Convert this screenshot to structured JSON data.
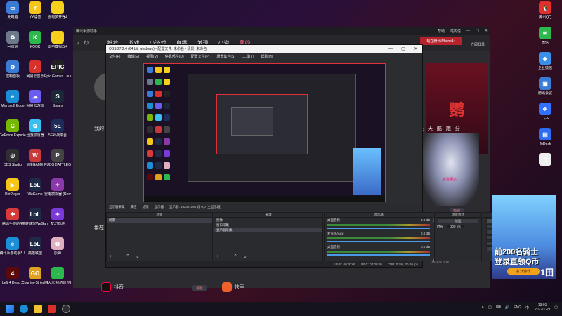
{
  "desktop_left": [
    {
      "label": "此电脑",
      "color": "#3a7bd5",
      "glyph": "▭"
    },
    {
      "label": "YY语音",
      "color": "#f5c518",
      "glyph": "Y"
    },
    {
      "label": "雷电多开器4",
      "color": "#f7d21a",
      "glyph": "⚡"
    },
    {
      "label": "回收站",
      "color": "#6d7a8c",
      "glyph": "♻"
    },
    {
      "label": "KOOK",
      "color": "#2db84d",
      "glyph": "K"
    },
    {
      "label": "雷电模拟器4",
      "color": "#f7d21a",
      "glyph": "⚡"
    },
    {
      "label": "控制面板",
      "color": "#3a7bd5",
      "glyph": "⚙"
    },
    {
      "label": "网易云音乐",
      "color": "#d8302a",
      "glyph": "♪"
    },
    {
      "label": "Epic Games Launcher",
      "color": "#222",
      "glyph": "EPIC"
    },
    {
      "label": "Microsoft Edge",
      "color": "#1a8fd8",
      "glyph": "e"
    },
    {
      "label": "网易云游戏",
      "color": "#6a5cf0",
      "glyph": "☁"
    },
    {
      "label": "Steam",
      "color": "#1b2838",
      "glyph": "S"
    },
    {
      "label": "GeForce Experience",
      "color": "#76b900",
      "glyph": "G"
    },
    {
      "label": "迅游加速器",
      "color": "#3ac0f0",
      "glyph": "✿"
    },
    {
      "label": "5E对战平台",
      "color": "#1e2c5a",
      "glyph": "5E"
    },
    {
      "label": "OBS Studio",
      "color": "#302e31",
      "glyph": "◎"
    },
    {
      "label": "WEGAME",
      "color": "#c83a3a",
      "glyph": "W"
    },
    {
      "label": "PUBG BATTLEGR...",
      "color": "#444",
      "glyph": "P"
    },
    {
      "label": "PotPlayer",
      "color": "#f5c518",
      "glyph": "▶"
    },
    {
      "label": "WeGame",
      "color": "#1f2a44",
      "glyph": "LoL"
    },
    {
      "label": "雷电模拟器 (Remixing...)",
      "color": "#8a3aa8",
      "glyph": "✧"
    },
    {
      "label": "腾讯手游助手",
      "color": "#d83a3a",
      "glyph": "✚"
    },
    {
      "label": "英雄联盟WeGame版",
      "color": "#1f2a44",
      "glyph": "LoL"
    },
    {
      "label": "梦幻西游",
      "color": "#7a3ad8",
      "glyph": "✦"
    },
    {
      "label": "腾讯手游助手5.0",
      "color": "#1a8fd8",
      "glyph": "e"
    },
    {
      "label": "英雄联盟",
      "color": "#1f2a44",
      "glyph": "LoL"
    },
    {
      "label": "原神",
      "color": "#e0b0c0",
      "glyph": "✿"
    },
    {
      "label": "Left 4 Dead 2",
      "color": "#5a0a0a",
      "glyph": "4"
    },
    {
      "label": "Counter-Strike Global Off...",
      "color": "#e0a020",
      "glyph": "GO"
    },
    {
      "label": "阿大米 我的世界启动器",
      "color": "#2db84d",
      "glyph": "♪"
    }
  ],
  "desktop_right": [
    {
      "label": "腾讯QQ",
      "color": "#e0302a",
      "glyph": "🐧"
    },
    {
      "label": "微信",
      "color": "#2db84d",
      "glyph": "✉"
    },
    {
      "label": "企业微信",
      "color": "#3a8fe8",
      "glyph": "◈"
    },
    {
      "label": "腾讯会议",
      "color": "#3a7bd5",
      "glyph": "▣"
    },
    {
      "label": "飞书",
      "color": "#3370ff",
      "glyph": "✈"
    },
    {
      "label": "ToDesk",
      "color": "#2d6cf0",
      "glyph": "▤"
    },
    {
      "label": "",
      "color": "#eeeeee",
      "glyph": "▯"
    }
  ],
  "bg_app": {
    "title": "腾讯手游助手",
    "title_actions": [
      "帮助",
      "站内信",
      "—",
      "▢",
      "✕"
    ],
    "nav_back": "‹",
    "nav_refresh": "↻",
    "tabs": [
      "推荐",
      "游戏",
      "小游戏",
      "直播",
      "发现",
      "小说",
      "我的"
    ],
    "active_tab": "我的",
    "login_label": "立即登录",
    "promo_btn": "玩在腾讯iPhone14",
    "left_label": "我的",
    "recommend_label": "推荐",
    "tagline": "天 天 酷 跑 分",
    "more_label": "查看更多",
    "side_texts": [
      "礼包"
    ],
    "small_buttons": [
      "领取",
      "领取",
      "领取",
      "领取"
    ],
    "right_item_text": "我先抢礼包",
    "bottom": [
      {
        "name": "抖音",
        "color": "#111"
      },
      {
        "name": "快手",
        "color": "#f0602a"
      }
    ],
    "big_char": "鹦"
  },
  "obs": {
    "title": "OBS 27.2.4 (64 bit, windows) - 配置文件: 未命名 - 场景: 未命名",
    "menu": [
      "文件(F)",
      "编辑(E)",
      "视图(V)",
      "停靠部件(D)",
      "配置文件(P)",
      "场景集合(S)",
      "工具(T)",
      "帮助(H)"
    ],
    "toolbar": [
      "显示器采集",
      "属性",
      "滤镜",
      "显示器",
      "显示器: 1920x1080 @ 0,0 (主显示器)"
    ],
    "scenes_header": "场景",
    "scenes": [
      "场景"
    ],
    "sources_header": "来源",
    "sources": [
      "图像",
      "窗口采集",
      "显示器采集"
    ],
    "mixer_header": "混音器",
    "mixer": [
      {
        "name": "桌面音频",
        "db": "0.0 dB"
      },
      {
        "name": "麦克风/Aux",
        "db": "0.0 dB"
      },
      {
        "name": "桌面音频",
        "db": "0.0 dB"
      }
    ],
    "transitions_header": "场景转场",
    "transition_type": "淡出",
    "duration_label": "时长",
    "duration_value": "300 ms",
    "controls_header": "控件",
    "controls": [
      "开始推流",
      "开始录制",
      "启动虚拟摄像机",
      "工作室模式",
      "设置",
      "退出"
    ],
    "active_control": "开始推流",
    "status": [
      "LIVE: 00:00:00",
      "REC: 00:00:00",
      "CPU: 0.7%, 30.00 fps"
    ],
    "footer_icons": "+ − ⌃ ⌄"
  },
  "ad": {
    "line1": "前200名骑士",
    "line2": "登录直领Q币",
    "button": "打开游戏",
    "corner": "1田"
  },
  "taskbar": {
    "tray": [
      "ᐱ",
      "◫",
      "⌨",
      "🔊",
      "ENG",
      "中"
    ],
    "time": "13:01",
    "date": "2022/12/9"
  }
}
